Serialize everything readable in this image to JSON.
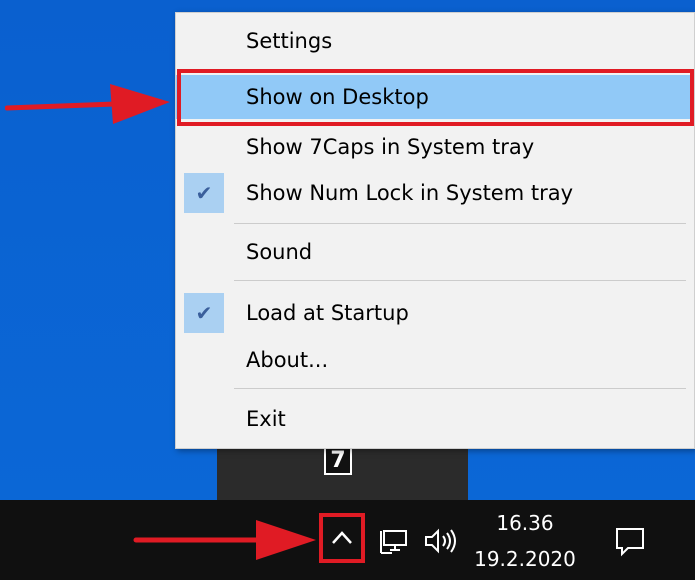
{
  "menu": {
    "items": [
      {
        "label": "Settings",
        "checked": false,
        "highlighted": false
      },
      {
        "label": "Show on Desktop",
        "checked": false,
        "highlighted": true
      },
      {
        "label": "Show 7Caps in System tray",
        "checked": false,
        "highlighted": false
      },
      {
        "label": "Show Num Lock in System tray",
        "checked": true,
        "highlighted": false
      },
      {
        "label": "Sound",
        "checked": false,
        "highlighted": false
      },
      {
        "label": "Load at Startup",
        "checked": true,
        "highlighted": false
      },
      {
        "label": "About...",
        "checked": false,
        "highlighted": false
      },
      {
        "label": "Exit",
        "checked": false,
        "highlighted": false
      }
    ],
    "check_glyph": "✔"
  },
  "flyout": {
    "app_icon_glyph": "7"
  },
  "taskbar": {
    "time": "16.36",
    "date": "19.2.2020"
  },
  "colors": {
    "annotation_red": "#e01b24",
    "highlight": "#91c9f7",
    "desktop_blue": "#0a64d0",
    "taskbar": "#101010"
  }
}
